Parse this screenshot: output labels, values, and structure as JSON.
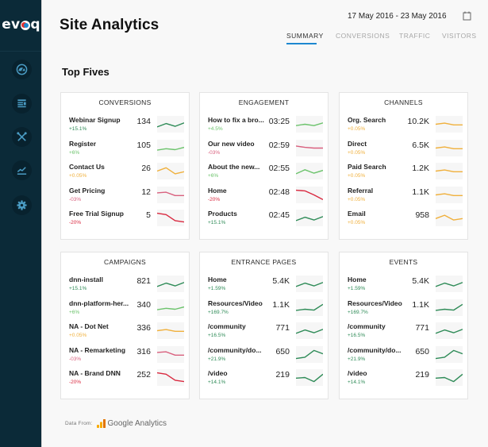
{
  "app": {
    "logo_text_left": "ev",
    "logo_text_right": "q",
    "title": "Site Analytics",
    "date_range": "17 May 2016 - 23 May 2016"
  },
  "sidebar": {
    "items": [
      {
        "name": "dashboard",
        "icon": "gauge-icon"
      },
      {
        "name": "content",
        "icon": "content-list-icon"
      },
      {
        "name": "tools",
        "icon": "tools-icon"
      },
      {
        "name": "analytics",
        "icon": "chart-line-icon"
      },
      {
        "name": "settings",
        "icon": "gear-icon"
      }
    ]
  },
  "tabs": [
    {
      "label": "SUMMARY",
      "active": true
    },
    {
      "label": "CONVERSIONS",
      "active": false
    },
    {
      "label": "TRAFFIC",
      "active": false
    },
    {
      "label": "VISITORS",
      "active": false
    }
  ],
  "section_title": "Top Fives",
  "colors": {
    "dark_green": "#2e8b57",
    "light_green": "#6cc36c",
    "orange": "#f0b03c",
    "pink": "#d9607e",
    "red": "#d9283f",
    "accent": "#1e88d0",
    "sidebar": "#0b2a38"
  },
  "cards": [
    {
      "title": "CONVERSIONS",
      "rows": [
        {
          "label": "Webinar Signup",
          "change": "+15.1%",
          "value": "134",
          "trend": "dark_green",
          "spark": [
            0.3,
            0.55,
            0.35,
            0.6
          ]
        },
        {
          "label": "Register",
          "change": "+6%",
          "value": "105",
          "trend": "light_green",
          "spark": [
            0.35,
            0.45,
            0.38,
            0.55
          ]
        },
        {
          "label": "Contact Us",
          "change": "+0.05%",
          "value": "26",
          "trend": "orange",
          "spark": [
            0.5,
            0.75,
            0.3,
            0.45
          ]
        },
        {
          "label": "Get Pricing",
          "change": "-03%",
          "value": "12",
          "trend": "pink",
          "spark": [
            0.65,
            0.7,
            0.45,
            0.45
          ]
        },
        {
          "label": "Free Trial Signup",
          "change": "-20%",
          "value": "5",
          "trend": "red",
          "spark": [
            0.85,
            0.75,
            0.3,
            0.2
          ]
        }
      ]
    },
    {
      "title": "ENGAGEMENT",
      "rows": [
        {
          "label": "How to fix a bro...",
          "change": "+4.5%",
          "value": "03:25",
          "trend": "light_green",
          "spark": [
            0.4,
            0.5,
            0.4,
            0.6
          ]
        },
        {
          "label": "Our new video",
          "change": "-03%",
          "value": "02:59",
          "trend": "pink",
          "spark": [
            0.65,
            0.55,
            0.5,
            0.5
          ]
        },
        {
          "label": "About the new...",
          "change": "+6%",
          "value": "02:55",
          "trend": "light_green",
          "spark": [
            0.3,
            0.6,
            0.35,
            0.55
          ]
        },
        {
          "label": "Home",
          "change": "-20%",
          "value": "02:48",
          "trend": "red",
          "spark": [
            0.85,
            0.8,
            0.5,
            0.15
          ]
        },
        {
          "label": "Products",
          "change": "+15.1%",
          "value": "02:45",
          "trend": "dark_green",
          "spark": [
            0.3,
            0.55,
            0.35,
            0.6
          ]
        }
      ]
    },
    {
      "title": "CHANNELS",
      "rows": [
        {
          "label": "Org. Search",
          "change": "+0.05%",
          "value": "10.2K",
          "trend": "orange",
          "spark": [
            0.5,
            0.58,
            0.45,
            0.45
          ]
        },
        {
          "label": "Direct",
          "change": "+0.05%",
          "value": "6.5K",
          "trend": "orange",
          "spark": [
            0.5,
            0.58,
            0.45,
            0.45
          ]
        },
        {
          "label": "Paid Search",
          "change": "+0.05%",
          "value": "1.2K",
          "trend": "orange",
          "spark": [
            0.5,
            0.58,
            0.45,
            0.45
          ]
        },
        {
          "label": "Referral",
          "change": "+0.05%",
          "value": "1.1K",
          "trend": "orange",
          "spark": [
            0.5,
            0.58,
            0.45,
            0.45
          ]
        },
        {
          "label": "Email",
          "change": "+0.05%",
          "value": "958",
          "trend": "orange",
          "spark": [
            0.45,
            0.7,
            0.35,
            0.45
          ]
        }
      ]
    },
    {
      "title": "CAMPAIGNS",
      "rows": [
        {
          "label": "dnn-install",
          "change": "+15.1%",
          "value": "821",
          "trend": "dark_green",
          "spark": [
            0.3,
            0.55,
            0.35,
            0.6
          ]
        },
        {
          "label": "dnn-platform-her...",
          "change": "+6%",
          "value": "340",
          "trend": "light_green",
          "spark": [
            0.35,
            0.45,
            0.38,
            0.55
          ]
        },
        {
          "label": "NA - Dot Net",
          "change": "+0.05%",
          "value": "336",
          "trend": "orange",
          "spark": [
            0.5,
            0.58,
            0.45,
            0.45
          ]
        },
        {
          "label": "NA - Remarketing",
          "change": "-03%",
          "value": "316",
          "trend": "pink",
          "spark": [
            0.65,
            0.7,
            0.45,
            0.45
          ]
        },
        {
          "label": "NA - Brand DNN",
          "change": "-20%",
          "value": "252",
          "trend": "red",
          "spark": [
            0.85,
            0.75,
            0.3,
            0.2
          ]
        }
      ]
    },
    {
      "title": "ENTRANCE PAGES",
      "rows": [
        {
          "label": "Home",
          "change": "+1.59%",
          "value": "5.4K",
          "trend": "dark_green",
          "spark": [
            0.3,
            0.55,
            0.35,
            0.6
          ]
        },
        {
          "label": "Resources/Video",
          "change": "+169.7%",
          "value": "1.1K",
          "trend": "dark_green",
          "spark": [
            0.3,
            0.38,
            0.32,
            0.75
          ]
        },
        {
          "label": "/community",
          "change": "+16.5%",
          "value": "771",
          "trend": "dark_green",
          "spark": [
            0.3,
            0.55,
            0.35,
            0.6
          ]
        },
        {
          "label": "/community/do...",
          "change": "+21.9%",
          "value": "650",
          "trend": "dark_green",
          "spark": [
            0.2,
            0.3,
            0.8,
            0.55
          ]
        },
        {
          "label": "/video",
          "change": "+14.1%",
          "value": "219",
          "trend": "dark_green",
          "spark": [
            0.45,
            0.5,
            0.2,
            0.75
          ]
        }
      ]
    },
    {
      "title": "EVENTS",
      "rows": [
        {
          "label": "Home",
          "change": "+1.59%",
          "value": "5.4K",
          "trend": "dark_green",
          "spark": [
            0.3,
            0.55,
            0.35,
            0.6
          ]
        },
        {
          "label": "Resources/Video",
          "change": "+169.7%",
          "value": "1.1K",
          "trend": "dark_green",
          "spark": [
            0.3,
            0.38,
            0.32,
            0.75
          ]
        },
        {
          "label": "/community",
          "change": "+16.5%",
          "value": "771",
          "trend": "dark_green",
          "spark": [
            0.3,
            0.55,
            0.35,
            0.6
          ]
        },
        {
          "label": "/community/do...",
          "change": "+21.9%",
          "value": "650",
          "trend": "dark_green",
          "spark": [
            0.2,
            0.3,
            0.8,
            0.55
          ]
        },
        {
          "label": "/video",
          "change": "+14.1%",
          "value": "219",
          "trend": "dark_green",
          "spark": [
            0.45,
            0.5,
            0.2,
            0.75
          ]
        }
      ]
    }
  ],
  "footer": {
    "label": "Data From:",
    "provider": "Google Analytics",
    "provider_icon": "google-analytics-icon"
  }
}
